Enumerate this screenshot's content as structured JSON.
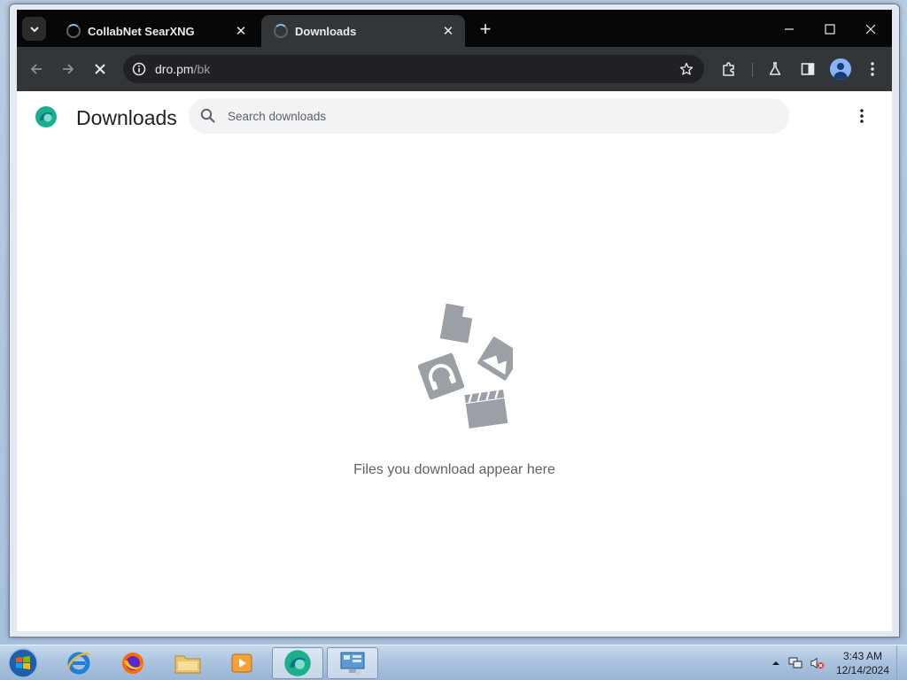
{
  "browser": {
    "tabs": [
      {
        "title": "CollabNet SearXNG",
        "active": false
      },
      {
        "title": "Downloads",
        "active": true
      }
    ],
    "address": {
      "host": "dro.pm",
      "path": "/bk"
    }
  },
  "page": {
    "title": "Downloads",
    "search_placeholder": "Search downloads",
    "empty_message": "Files you download appear here"
  },
  "taskbar": {
    "apps": [
      "internet-explorer",
      "firefox",
      "file-explorer",
      "media-player",
      "browser",
      "control-panel"
    ],
    "active_app": "browser",
    "clock": {
      "time": "3:43 AM",
      "date": "12/14/2024"
    }
  },
  "colors": {
    "tab_strip": "#070707",
    "toolbar": "#323639",
    "omnibox": "#202124",
    "empty_art": "#9aa0a6",
    "logo_teal": "#1bb08c"
  }
}
